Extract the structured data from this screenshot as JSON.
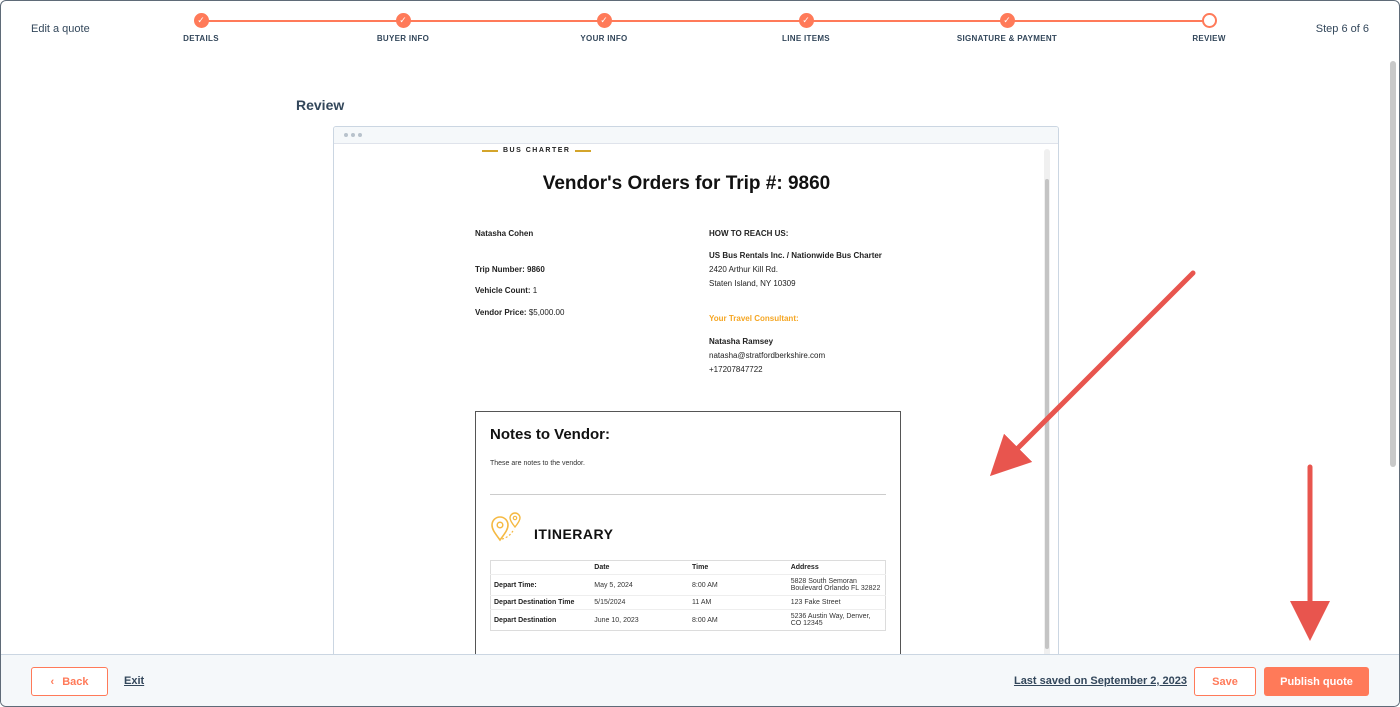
{
  "header": {
    "title": "Edit a quote",
    "step_count": "Step 6 of 6",
    "steps": [
      {
        "label": "DETAILS",
        "status": "complete"
      },
      {
        "label": "BUYER INFO",
        "status": "complete"
      },
      {
        "label": "YOUR INFO",
        "status": "complete"
      },
      {
        "label": "LINE ITEMS",
        "status": "complete"
      },
      {
        "label": "SIGNATURE & PAYMENT",
        "status": "complete"
      },
      {
        "label": "REVIEW",
        "status": "current"
      }
    ]
  },
  "main": {
    "section_title": "Review"
  },
  "document": {
    "brand": "BUS CHARTER",
    "title": "Vendor's Orders for Trip #: 9860",
    "left": {
      "name": "Natasha Cohen",
      "trip_number_label": "Trip Number:",
      "trip_number": "9860",
      "vehicle_count_label": "Vehicle Count:",
      "vehicle_count": "1",
      "vendor_price_label": "Vendor Price:",
      "vendor_price": "$5,000.00"
    },
    "right": {
      "reach_us": "HOW TO REACH US:",
      "company": "US Bus Rentals Inc. / Nationwide Bus Charter",
      "address1": "2420 Arthur Kill Rd.",
      "address2": "Staten Island, NY 10309",
      "consultant_label": "Your Travel Consultant:",
      "consultant_name": "Natasha Ramsey",
      "consultant_email": "natasha@stratfordberkshire.com",
      "consultant_phone": "+17207847722"
    },
    "notes": {
      "title": "Notes to Vendor:",
      "text": "These are notes to the vendor."
    },
    "itinerary": {
      "title": "ITINERARY",
      "columns": [
        "",
        "Date",
        "Time",
        "Address"
      ],
      "rows": [
        {
          "label": "Depart Time:",
          "date": "May 5, 2024",
          "time": "8:00 AM",
          "address": "5828 South Semoran Boulevard Orlando FL 32822"
        },
        {
          "label": "Depart Destination Time",
          "date": "5/15/2024",
          "time": "11 AM",
          "address": "123 Fake Street"
        },
        {
          "label": "Depart Destination",
          "date": "June 10, 2023",
          "time": "8:00 AM",
          "address": "5236 Austin Way, Denver, CO 12345"
        }
      ]
    }
  },
  "footer": {
    "back_label": "Back",
    "exit_label": "Exit",
    "last_saved": "Last saved on September 2, 2023",
    "save_label": "Save",
    "publish_label": "Publish quote"
  },
  "colors": {
    "accent": "#ff7a59",
    "text": "#33475b",
    "annotation_arrow": "#e8554e",
    "brand_gold": "#d4a52b",
    "consultant_orange": "#f5a623"
  },
  "icons": [
    "checkmark-icon",
    "chevron-left-icon",
    "map-pin-icon"
  ]
}
